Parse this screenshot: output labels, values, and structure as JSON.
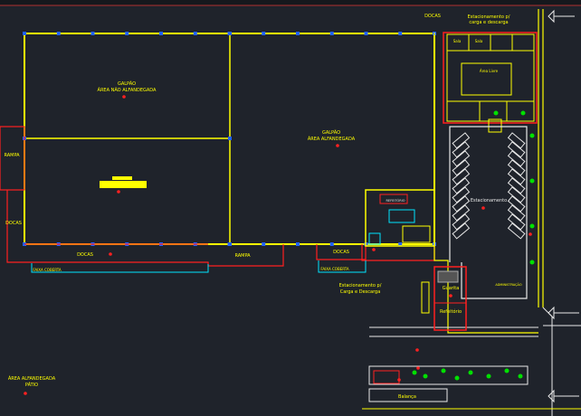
{
  "labels": {
    "galpao_left": [
      "GALPÃO",
      "ÁREA NÃO ALFANDEGADA"
    ],
    "galpao_right": [
      "GALPÃO",
      "ÁREA ALFANDEGADA"
    ],
    "rampa_left": "RAMPA",
    "rampa_bottom": "RAMPA",
    "docas_left": "DOCAS",
    "docas_bottom": "DOCAS",
    "docas_top": "DOCAS",
    "docas_mid": "DOCAS",
    "faixa_left": "FAIXA COBERTA",
    "faixa_right": "FAIXA COBERTA",
    "estac_top": [
      "Estacionamento p/",
      "carga e descarga"
    ],
    "estac_main": "Estacionamento",
    "estac_bottom": [
      "Estacionamento p/",
      "Carga e Descarga"
    ],
    "area_patio": [
      "ÁREA ALFANDEGADA",
      "PÁTIO"
    ],
    "guarita": "Guarita",
    "refeitorio": "Refeitório",
    "balanca": "Balança",
    "room_a": "Sala",
    "room_b": "Sala",
    "room_c": "Área Livre",
    "small_label": "REFEITÓRIO",
    "admin_label": "ADMINISTRAÇÃO",
    "cota": "0,00"
  },
  "colors": {
    "background": "#1f232b",
    "wall": "#ffff00",
    "red": "#ff2020",
    "cyan": "#00e5ff",
    "white": "#e8e8e8",
    "blue": "#2060ff",
    "green": "#00e000"
  }
}
